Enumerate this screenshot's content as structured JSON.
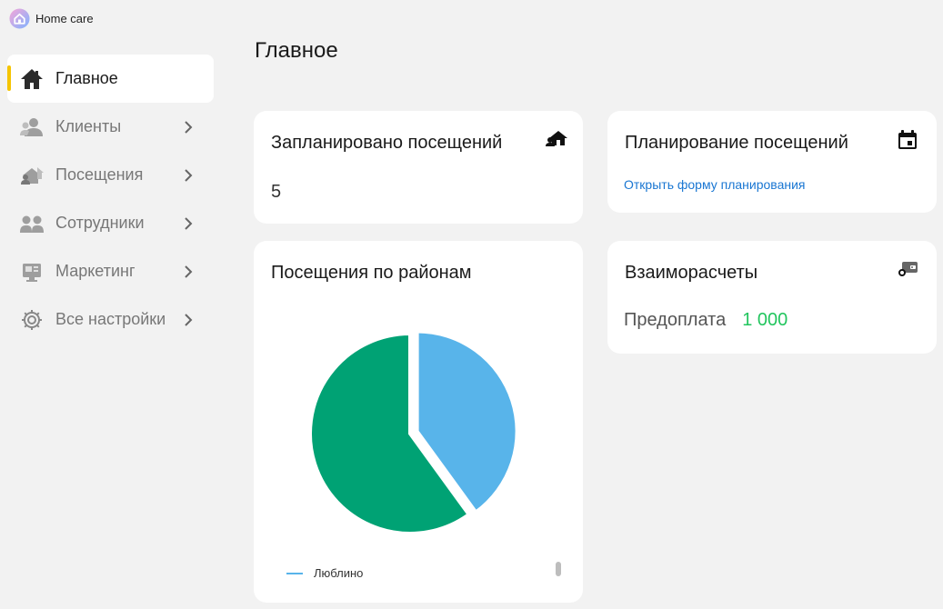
{
  "brand": {
    "name": "Home care"
  },
  "page": {
    "title": "Главное"
  },
  "sidebar": {
    "items": [
      {
        "label": "Главное",
        "icon": "home-icon",
        "active": true
      },
      {
        "label": "Клиенты",
        "icon": "clients-icon"
      },
      {
        "label": "Посещения",
        "icon": "visits-icon"
      },
      {
        "label": "Сотрудники",
        "icon": "employees-icon"
      },
      {
        "label": "Маркетинг",
        "icon": "marketing-icon"
      },
      {
        "label": "Все настройки",
        "icon": "gear-icon"
      }
    ]
  },
  "cards": {
    "planned": {
      "title": "Запланировано посещений",
      "value": "5",
      "icon": "houses-icon"
    },
    "planning": {
      "title": "Планирование посещений",
      "link": "Открыть форму планирования",
      "icon": "calendar-icon"
    },
    "districts": {
      "title": "Посещения по районам",
      "legend": [
        {
          "label": "Люблино",
          "color": "#58b4ea"
        }
      ]
    },
    "settlements": {
      "title": "Взаиморасчеты",
      "label": "Предоплата",
      "value": "1 000",
      "value_color": "#22c55e",
      "icon": "wallet-icon"
    }
  },
  "colors": {
    "accent": "#f5c400",
    "link": "#1976d2",
    "pie_blue": "#58b4ea",
    "pie_green": "#00a274"
  },
  "chart_data": {
    "type": "pie",
    "title": "Посещения по районам",
    "slices": [
      {
        "label": "Люблино",
        "value": 40,
        "color": "#58b4ea"
      },
      {
        "label": "",
        "value": 60,
        "color": "#00a274"
      }
    ],
    "legend": [
      "Люблино"
    ]
  }
}
